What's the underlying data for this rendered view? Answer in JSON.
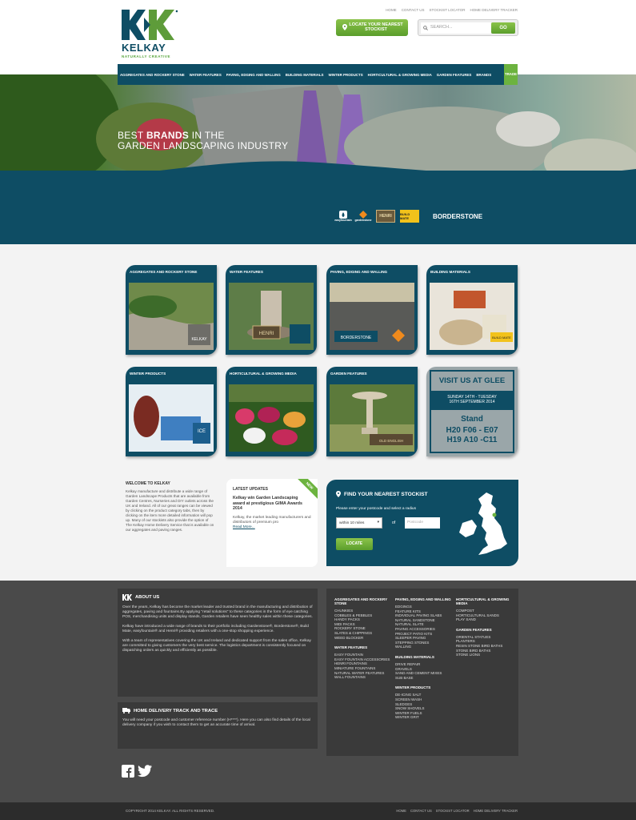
{
  "header": {
    "logo_name": "KELKAY",
    "logo_tagline": "NATURALLY CREATIVE",
    "top_links": [
      "HOME",
      "CONTACT US",
      "STOCKIST LOCATOR",
      "HOME DELIVERY TRACKER"
    ],
    "locate_button": "LOCATE YOUR NEAREST STOCKIST",
    "search_placeholder": "SEARCH...",
    "search_go": "GO"
  },
  "nav": {
    "items": [
      "AGGREGATES AND ROCKERY STONE",
      "WATER FEATURES",
      "PAVING, EDGING AND WALLING",
      "BUILDING MATERIALS",
      "WINTER PRODUCTS",
      "HORTICULTURAL & GROWING MEDIA",
      "GARDEN FEATURES",
      "BRANDS"
    ],
    "trade": "TRADE"
  },
  "hero": {
    "title_pre": "BEST ",
    "title_bold": "BRANDS",
    "title_post": " IN THE",
    "title_line2": "GARDEN LANDSCAPING INDUSTRY",
    "brands": [
      "easyfountain",
      "gardenstone",
      "HENRI",
      "BUILD MATE",
      "BORDERSTONE"
    ]
  },
  "categories": [
    {
      "title": "AGGREGATES AND ROCKERY STONE",
      "badge": "KELKAY"
    },
    {
      "title": "WATER FEATURES",
      "badge": "HENRI"
    },
    {
      "title": "PAVING, EDGING AND WALLING",
      "badge": "BORDERSTONE"
    },
    {
      "title": "BUILDING MATERIALS",
      "badge": "BUILD MATE"
    },
    {
      "title": "WINTER PRODUCTS",
      "badge": "ICE"
    },
    {
      "title": "HORTICULTURAL & GROWING MEDIA",
      "badge": ""
    },
    {
      "title": "GARDEN FEATURES",
      "badge": "OLD ENGLISH"
    }
  ],
  "glee": {
    "title": "VISIT US AT GLEE",
    "dates": "SUNDAY 14TH - TUESDAY 16TH SEPTEMBER 2014",
    "stand": "Stand",
    "line1": "H20 F06 - E07",
    "line2": "H19 A10 -C11"
  },
  "welcome": {
    "title": "WELCOME TO KELKAY",
    "text": "Kelkay manufacture and distribute a wide range of Garden Landscape Products that are available from Garden Centres, Nurseries and DIY outlets across the UK and Ireland. All of our great ranges can be viewed by clicking on the product category tabs, then by clicking on the item more detailed information will pop up. Many of our stockists also provide the option of The Kelkay Home Delivery Service that is available on our aggregates and paving ranges."
  },
  "updates": {
    "title": "LATEST UPDATES",
    "ribbon": "NEW",
    "headline": "Kelkay win Garden Landscaping award at prestigious GIMA Awards 2014",
    "text": "Kelkay, the market leading manufacturers and distributors of premium pro",
    "more": "Read More..."
  },
  "stockist": {
    "title": "FIND YOUR NEAREST STOCKIST",
    "subtitle": "Please enter your postcode and select a radius",
    "radius": "within 10 miles",
    "of": "of",
    "postcode_placeholder": "Postcode",
    "button": "LOCATE"
  },
  "footer": {
    "about_title": "ABOUT US",
    "about_p1": "Over the years, Kelkay has become the market leader and trusted brand in the manufacturing and distribution of aggregates, paving and fountains.By applying \"retail solutions\" to these categories in the form of eye catching POS, merchandising units and display stands, Garden retailers have seen healthy sales within these categories.",
    "about_p2": "Kelkay have introduced a wide range of brands to their portfolio including Gardenstone®, Borderstone®, Build Mate, easyfountain® and Henri® providing retailers with a one-stop shopping experience.",
    "about_p3": "With a team of representatives covering the UK and Ireland and dedicated support from the sales office, Kelkay are committed to giving customers the very best service. The logistics department is consistently focused on dispatching orders as quickly and efficiently as possible.",
    "delivery_title": "HOME DELIVERY TRACK AND TRACE",
    "delivery_text": "You will need your postcode and customer reference number (H****). Here you can also find details of the local delivery company if you wish to contact them to get an accurate time of arrival.",
    "col1": [
      {
        "heading": "AGGREGATES AND ROCKERY STONE",
        "items": [
          "CHUNKIES",
          "COBBLES & PEBBLES",
          "HANDY PACKS",
          "MIDI PACKS",
          "ROCKERY STONE",
          "SLATES & CHIPPINGS",
          "WEED BLOCKER"
        ]
      },
      {
        "heading": "WATER FEATURES",
        "items": [
          "EASY FOUNTAIN",
          "EASY FOUNTAIN ACCESSORIES",
          "HENRI FOUNTAINS",
          "MINIATURE FOUNTAINS",
          "NATURAL WATER FEATURES",
          "WALL FOUNTAINS"
        ]
      }
    ],
    "col2": [
      {
        "heading": "PAVING, EDGING AND WALLING",
        "items": [
          "EDGINGS",
          "FEATURE KITS",
          "INDIVIDUAL PAVING SLABS",
          "NATURAL SANDSTONE",
          "NATURAL SLATE",
          "PAVING ACCESSORIES",
          "PROJECT PATIO KITS",
          "SLEEPER PAVING",
          "STEPPING STONES",
          "WALLING"
        ]
      },
      {
        "heading": "BUILDING MATERIALS",
        "items": [
          "DRIVE REPAIR",
          "GRAVELS",
          "SAND AND CEMENT MIXES",
          "SUB BASE"
        ]
      },
      {
        "heading": "WINTER PRODUCTS",
        "items": [
          "DE-ICING SALT",
          "SCREEN WASH",
          "SLEDGES",
          "SNOW SHOVELS",
          "WINTER FUELS",
          "WINTER GRIT"
        ]
      }
    ],
    "col3": [
      {
        "heading": "HORTICULTURAL & GROWING MEDIA",
        "items": [
          "COMPOST",
          "HORTICULTURAL SANDS",
          "PLAY SAND"
        ]
      },
      {
        "heading": "GARDEN FEATURES",
        "items": [
          "ORIENTAL STATUES",
          "PLANTERS",
          "RESIN STONE BIRD BATHS",
          "STONE BIRD BATHS",
          "STONE LIONS"
        ]
      }
    ],
    "copyright": "COPYRIGHT 2014 KELKAY. ALL RIGHTS RESERVED.",
    "bottom_links": [
      "HOME",
      "CONTACT US",
      "STOCKIST LOCATOR",
      "HOME DELIVERY TRACKER"
    ]
  },
  "colors": {
    "brand_teal": "#0e4d64",
    "brand_green": "#6cb33f",
    "footer_dark": "#3a3a3a"
  }
}
